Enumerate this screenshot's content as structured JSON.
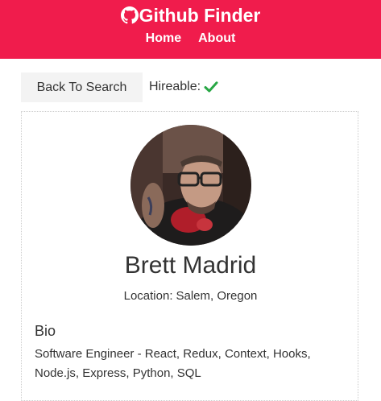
{
  "navbar": {
    "brand_icon": "github-icon",
    "title": "Github Finder",
    "links": [
      "Home",
      "About"
    ],
    "background_color": "#f01c4c"
  },
  "actions": {
    "back_label": "Back To Search"
  },
  "hireable": {
    "label": "Hireable:",
    "status_icon": "check-icon",
    "status_color": "#28a745"
  },
  "profile": {
    "name": "Brett Madrid",
    "location_label": "Location:",
    "location": "Salem, Oregon",
    "bio_heading": "Bio",
    "bio_lines": [
      "Software Engineer - React, Redux, Context, Hooks,",
      "Node.js, Express, Python, SQL"
    ]
  }
}
